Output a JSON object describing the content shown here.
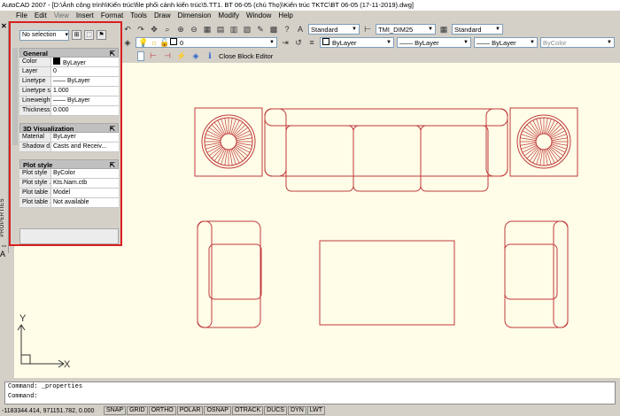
{
  "window": {
    "title": "AutoCAD 2007 - [D:\\Ảnh công trình\\Kiến trúc\\file phối cảnh kiến trúc\\5.TT1. BT 06-05 (chú Thọ)\\Kiến trúc TKTC\\BT 06-05 (17-11-2019).dwg]"
  },
  "menu": [
    "File",
    "Edit",
    "View",
    "Insert",
    "Format",
    "Tools",
    "Draw",
    "Dimension",
    "Modify",
    "Window",
    "Help"
  ],
  "toolbar": {
    "layer_value": "0",
    "text_style": "Standard",
    "dim_style": "TMI_DIM25",
    "table_style": "Standard",
    "color": "ByLayer",
    "linetype": "ByLayer",
    "lineweight": "ByLayer",
    "plotstyle": "ByColor",
    "block_editor": "Close Block Editor"
  },
  "palette": {
    "selection": "No selection",
    "vertical_label": "PROPERTIES",
    "general": {
      "title": "General",
      "rows": [
        {
          "k": "Color",
          "v": "ByLayer"
        },
        {
          "k": "Layer",
          "v": "0"
        },
        {
          "k": "Linetype",
          "v": "ByLayer"
        },
        {
          "k": "Linetype s...",
          "v": "1.000"
        },
        {
          "k": "Lineweight",
          "v": "ByLayer"
        },
        {
          "k": "Thickness",
          "v": "0.000"
        }
      ]
    },
    "viz": {
      "title": "3D Visualization",
      "rows": [
        {
          "k": "Material",
          "v": "ByLayer"
        },
        {
          "k": "Shadow d...",
          "v": "Casts and Receiv..."
        }
      ]
    },
    "plot": {
      "title": "Plot style",
      "rows": [
        {
          "k": "Plot style",
          "v": "ByColor"
        },
        {
          "k": "Plot style ...",
          "v": "Kts.Nam.ctb"
        },
        {
          "k": "Plot table ...",
          "v": "Model"
        },
        {
          "k": "Plot table ...",
          "v": "Not available"
        }
      ]
    }
  },
  "ucs": {
    "x": "X",
    "y": "Y"
  },
  "command": {
    "line1": "Command: _properties",
    "line2": "Command:"
  },
  "status": {
    "coords": "-1183344.414, 971151.782, 0.000",
    "buttons": [
      "SNAP",
      "GRID",
      "ORTHO",
      "POLAR",
      "OSNAP",
      "OTRACK",
      "DUCS",
      "DYN",
      "LWT"
    ]
  },
  "colors": {
    "drawing_bg": "#fffde8",
    "line": "#c0393b",
    "highlight": "#d92020"
  }
}
